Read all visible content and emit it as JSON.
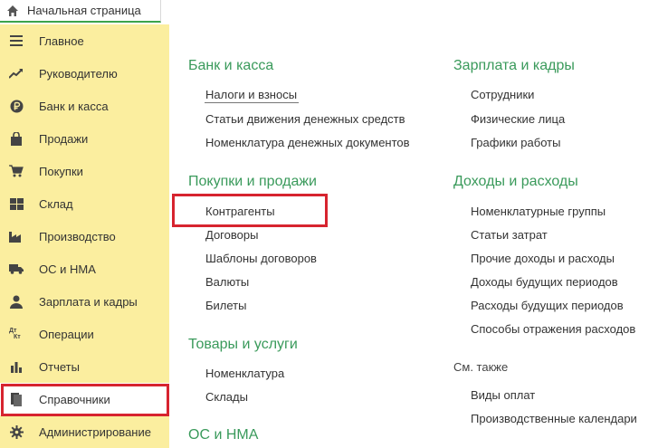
{
  "home_tab": {
    "label": "Начальная страница",
    "icon": "home-icon"
  },
  "sidebar": {
    "items": [
      {
        "label": "Главное",
        "icon": "menu-lines-icon"
      },
      {
        "label": "Руководителю",
        "icon": "trend-up-icon"
      },
      {
        "label": "Банк и касса",
        "icon": "ruble-coin-icon"
      },
      {
        "label": "Продажи",
        "icon": "shopping-bag-icon"
      },
      {
        "label": "Покупки",
        "icon": "cart-icon"
      },
      {
        "label": "Склад",
        "icon": "warehouse-grid-icon"
      },
      {
        "label": "Производство",
        "icon": "factory-icon"
      },
      {
        "label": "ОС и НМА",
        "icon": "truck-icon"
      },
      {
        "label": "Зарплата и кадры",
        "icon": "person-icon"
      },
      {
        "label": "Операции",
        "icon": "dt-kt-icon"
      },
      {
        "label": "Отчеты",
        "icon": "bar-chart-icon"
      },
      {
        "label": "Справочники",
        "icon": "books-icon"
      },
      {
        "label": "Администрирование",
        "icon": "gear-icon"
      }
    ],
    "active_index": 11,
    "dt_label": "Дт",
    "kt_label": "Кт"
  },
  "main": {
    "left": [
      {
        "title": "Банк и касса",
        "links": [
          "Налоги и взносы",
          "Статьи движения денежных средств",
          "Номенклатура денежных документов"
        ]
      },
      {
        "title": "Покупки и продажи",
        "links": [
          "Контрагенты",
          "Договоры",
          "Шаблоны договоров",
          "Валюты",
          "Билеты"
        ]
      },
      {
        "title": "Товары и услуги",
        "links": [
          "Номенклатура",
          "Склады"
        ]
      },
      {
        "title": "ОС и НМА",
        "links": []
      }
    ],
    "right": [
      {
        "title": "Зарплата и кадры",
        "links": [
          "Сотрудники",
          "Физические лица",
          "Графики работы"
        ]
      },
      {
        "title": "Доходы и расходы",
        "links": [
          "Номенклатурные группы",
          "Статьи затрат",
          "Прочие доходы и расходы",
          "Доходы будущих периодов",
          "Расходы будущих периодов",
          "Способы отражения расходов"
        ]
      }
    ],
    "see_also": {
      "label": "См. также",
      "links": [
        "Виды оплат",
        "Производственные календари"
      ]
    }
  },
  "colors": {
    "sidebar_bg": "#fbee9f",
    "section_title": "#3a9a5b",
    "highlight": "#d7242f",
    "tab_underline": "#3ba44c"
  }
}
